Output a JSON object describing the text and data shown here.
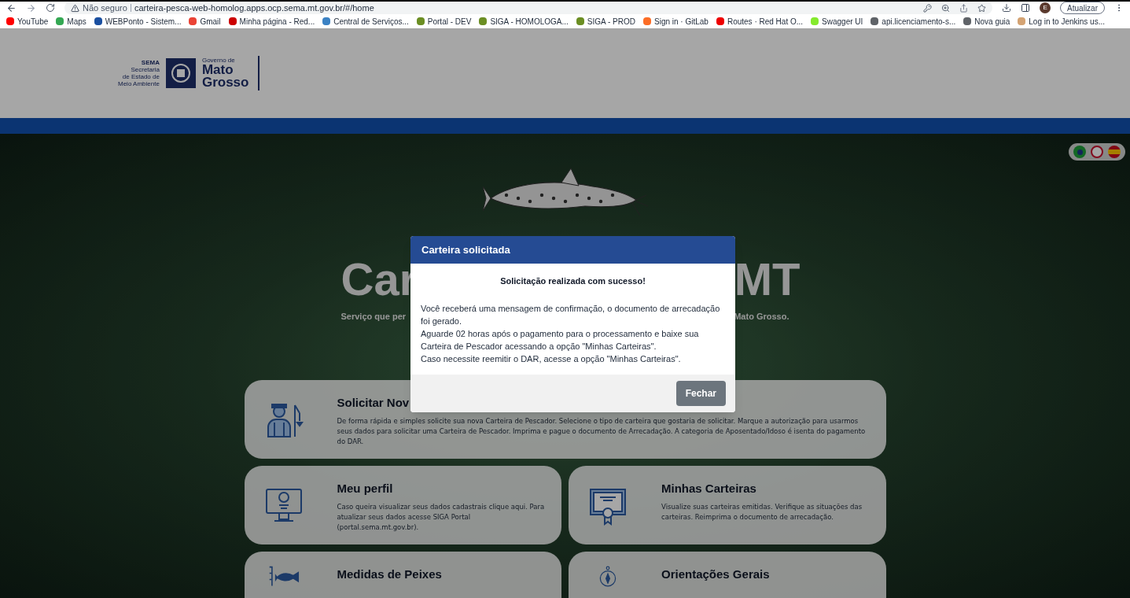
{
  "browser": {
    "security": "Não seguro",
    "url": "carteira-pesca-web-homolog.apps.ocp.sema.mt.gov.br/#/home",
    "profile_initial": "E",
    "update_button": "Atualizar"
  },
  "bookmarks": [
    {
      "label": "YouTube",
      "color": "#ff0000"
    },
    {
      "label": "Maps",
      "color": "#34a853"
    },
    {
      "label": "WEBPonto - Sistem...",
      "color": "#1a4fa0"
    },
    {
      "label": "Gmail",
      "color": "#ea4335"
    },
    {
      "label": "Minha página - Red...",
      "color": "#cc0000"
    },
    {
      "label": "Central de Serviços...",
      "color": "#3b82c4"
    },
    {
      "label": "Portal - DEV",
      "color": "#6b8e23"
    },
    {
      "label": "SIGA - HOMOLOGA...",
      "color": "#6b8e23"
    },
    {
      "label": "SIGA - PROD",
      "color": "#6b8e23"
    },
    {
      "label": "Sign in · GitLab",
      "color": "#fc6d26"
    },
    {
      "label": "Routes · Red Hat O...",
      "color": "#ee0000"
    },
    {
      "label": "Swagger UI",
      "color": "#85ea2d"
    },
    {
      "label": "api.licenciamento-s...",
      "color": "#5f6368"
    },
    {
      "label": "Nova guia",
      "color": "#5f6368"
    },
    {
      "label": "Log in to Jenkins us...",
      "color": "#d4a373"
    }
  ],
  "header": {
    "agency_lines": [
      "SEMA",
      "Secretaria",
      "de Estado de",
      "Meio Ambiente"
    ],
    "gov_small": "Governo de",
    "gov_big": [
      "Mato",
      "Grosso"
    ]
  },
  "hero": {
    "title_parts": [
      "Car",
      "MT"
    ],
    "subtitle_parts": [
      "Serviço que per",
      "Mato Grosso."
    ]
  },
  "cards": [
    {
      "title": "Solicitar Nov",
      "text": "De forma rápida e simples solicite sua nova Carteira de Pescador. Selecione o tipo de carteira que gostaria de solicitar. Marque a autorização para usarmos seus dados para solicitar uma Carteira de Pescador. Imprima e pague o documento de Arrecadação. A categoria de Aposentado/Idoso é isenta do pagamento do DAR.",
      "wide": true
    },
    {
      "title": "Meu perfil",
      "text": "Caso queira visualizar seus dados cadastrais clique aqui. Para atualizar seus dados acesse SIGA Portal (portal.sema.mt.gov.br).",
      "wide": false
    },
    {
      "title": "Minhas Carteiras",
      "text": "Visualize suas carteiras emitidas. Verifique as situações das carteiras. Reimprima o documento de arrecadação.",
      "wide": false
    },
    {
      "title": "Medidas de Peixes",
      "wide": false
    },
    {
      "title": "Orientações Gerais",
      "wide": false
    }
  ],
  "modal": {
    "title": "Carteira solicitada",
    "heading": "Solicitação realizada com sucesso!",
    "lines": [
      "Você receberá uma mensagem de confirmação, o documento de arrecadação foi gerado.",
      "Aguarde 02 horas após o pagamento para o processamento e baixe sua Carteira de Pescador acessando a opção \"Minhas Carteiras\".",
      "Caso necessite reemitir o DAR, acesse a opção \"Minhas Carteiras\"."
    ],
    "button": "Fechar"
  }
}
